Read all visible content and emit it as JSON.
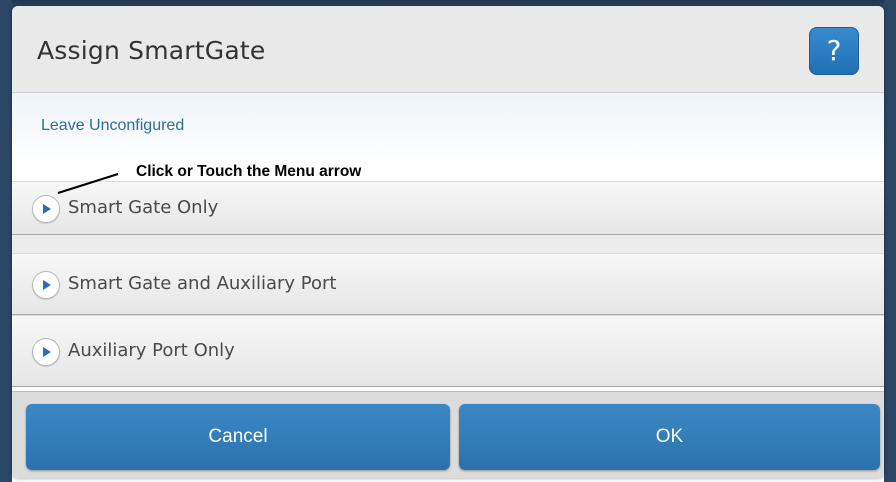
{
  "dialog": {
    "title": "Assign SmartGate",
    "help_label": "?"
  },
  "body": {
    "leave_unconfigured": "Leave Unconfigured",
    "callout": "Click or Touch the Menu arrow",
    "options": [
      {
        "label": "Smart Gate Only",
        "icon": "expand-arrow-icon"
      },
      {
        "label": "Smart Gate and Auxiliary Port",
        "icon": "expand-arrow-icon"
      },
      {
        "label": "Auxiliary Port Only",
        "icon": "expand-arrow-icon"
      }
    ]
  },
  "footer": {
    "cancel_label": "Cancel",
    "ok_label": "OK"
  },
  "colors": {
    "accent": "#2f7bb8",
    "arrow": "#2a6db5",
    "link": "#2d6d9c"
  }
}
